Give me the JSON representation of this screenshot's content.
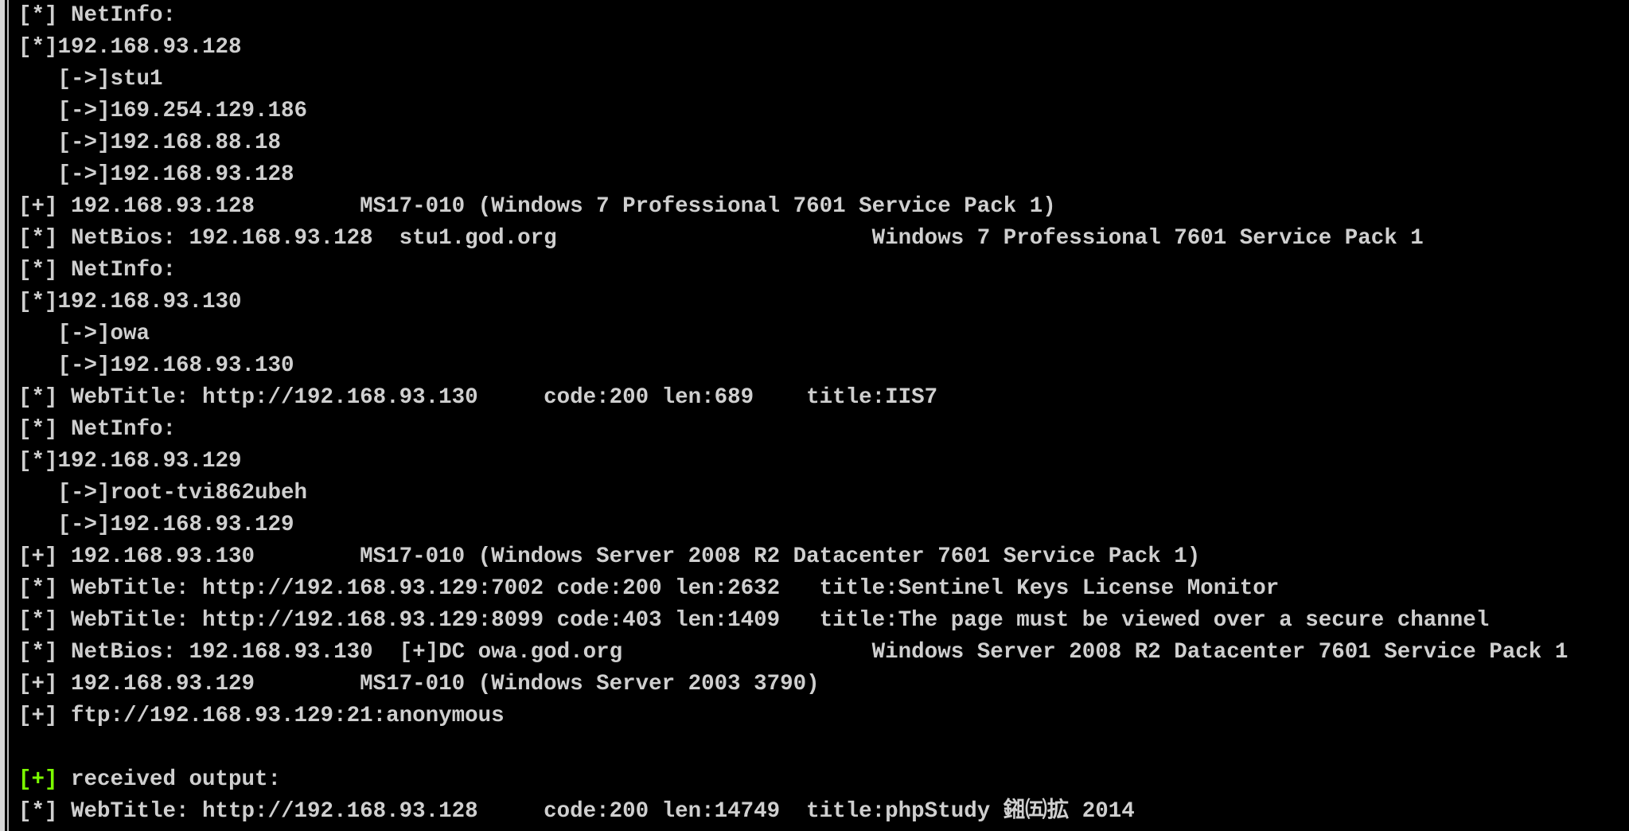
{
  "terminal": {
    "lines": [
      "[*] NetInfo:",
      "[*]192.168.93.128",
      "   [->]stu1",
      "   [->]169.254.129.186",
      "   [->]192.168.88.18",
      "   [->]192.168.93.128",
      "[+] 192.168.93.128        MS17-010 (Windows 7 Professional 7601 Service Pack 1)",
      "[*] NetBios: 192.168.93.128  stu1.god.org                        Windows 7 Professional 7601 Service Pack 1",
      "[*] NetInfo:",
      "[*]192.168.93.130",
      "   [->]owa",
      "   [->]192.168.93.130",
      "[*] WebTitle: http://192.168.93.130     code:200 len:689    title:IIS7",
      "[*] NetInfo:",
      "[*]192.168.93.129",
      "   [->]root-tvi862ubeh",
      "   [->]192.168.93.129",
      "[+] 192.168.93.130        MS17-010 (Windows Server 2008 R2 Datacenter 7601 Service Pack 1)",
      "[*] WebTitle: http://192.168.93.129:7002 code:200 len:2632   title:Sentinel Keys License Monitor",
      "[*] WebTitle: http://192.168.93.129:8099 code:403 len:1409   title:The page must be viewed over a secure channel",
      "[*] NetBios: 192.168.93.130  [+]DC owa.god.org                   Windows Server 2008 R2 Datacenter 7601 Service Pack 1",
      "[+] 192.168.93.129        MS17-010 (Windows Server 2003 3790)",
      "[+] ftp://192.168.93.129:21:anonymous",
      ""
    ],
    "received_prefix": "[+]",
    "received_text": " received output:",
    "last_line": "[*] WebTitle: http://192.168.93.128     code:200 len:14749  title:phpStudy 鎺㈤拡 2014"
  },
  "colors": {
    "background": "#000000",
    "text": "#cfcfcf",
    "success_prefix": "#7cfc00"
  }
}
